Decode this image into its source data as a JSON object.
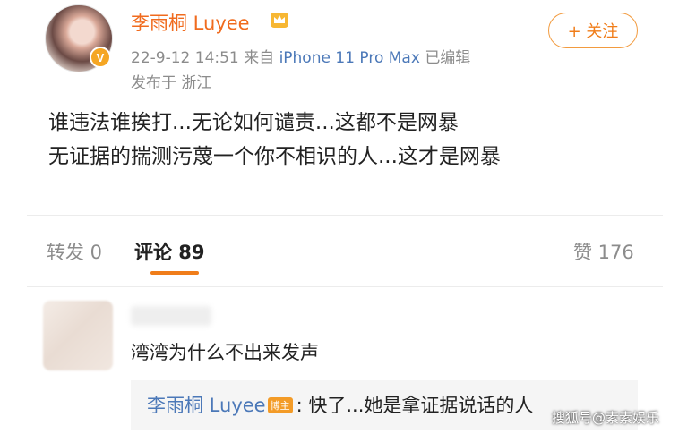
{
  "post": {
    "author": "李雨桐 Luyee",
    "time": "22-9-12 14:51",
    "from_prefix": "来自",
    "device": "iPhone 11 Pro Max",
    "edited": "已编辑",
    "location": "发布于 浙江",
    "follow_label": "+ 关注",
    "verified_mark": "V",
    "content": [
      "谁违法谁挨打...无论如何谴责...这都不是网暴",
      "无证据的揣测污蔑一个你不相识的人...这才是网暴"
    ]
  },
  "tabs": {
    "repost": "转发 0",
    "comments": "评论 89",
    "likes": "赞 176"
  },
  "comment": {
    "text": "湾湾为什么不出来发声",
    "reply_author": "李雨桐 Luyee",
    "reply_badge": "博主",
    "reply_text": ": 快了...她是拿证据说话的人"
  },
  "watermark": "搜狐号@素素娱乐",
  "colors": {
    "accent": "#f07d1a",
    "link": "#4b78b8",
    "muted": "#8c8c8c"
  },
  "icons": {
    "crown": "crown-icon",
    "verified": "verified-badge-icon"
  }
}
